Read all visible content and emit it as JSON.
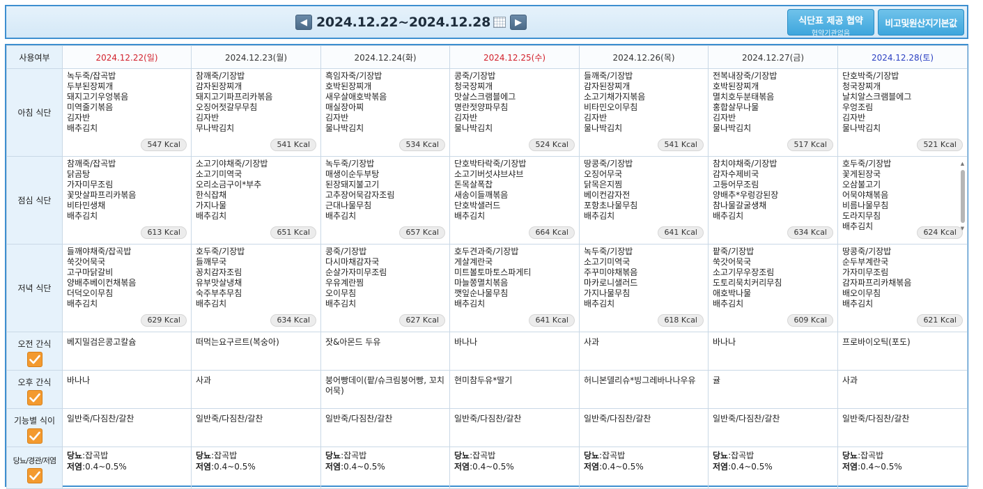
{
  "header": {
    "date_range": "2024.12.22~2024.12.28",
    "prev_icon": "chevron-left-icon",
    "next_icon": "chevron-right-icon",
    "calendar_icon": "calendar-icon",
    "provide_btn_line1": "식단표 제공 협약",
    "provide_btn_line2": "협약기관없음",
    "origin_btn": "비고및원산지기본값"
  },
  "table": {
    "corner_label": "사용여부",
    "days": [
      {
        "label": "2024.12.22(일)",
        "kind": "sun"
      },
      {
        "label": "2024.12.23(월)",
        "kind": "normal"
      },
      {
        "label": "2024.12.24(화)",
        "kind": "normal"
      },
      {
        "label": "2024.12.25(수)",
        "kind": "hol"
      },
      {
        "label": "2024.12.26(목)",
        "kind": "normal"
      },
      {
        "label": "2024.12.27(금)",
        "kind": "normal"
      },
      {
        "label": "2024.12.28(토)",
        "kind": "sat"
      }
    ],
    "meals": [
      {
        "label": "아침 식단",
        "days": [
          {
            "items": [
              "녹두죽/잡곡밥",
              "두부된장찌개",
              "돼지고기우엉볶음",
              "미역줄기볶음",
              "김자반",
              "배추김치"
            ],
            "kcal": "547 Kcal"
          },
          {
            "items": [
              "참깨죽/기장밥",
              "감자된장찌개",
              "돼지고기파프리카볶음",
              "오징어젓갈무무침",
              "김자반",
              "무나박김치"
            ],
            "kcal": "541 Kcal"
          },
          {
            "items": [
              "흑임자죽/기장밥",
              "호박된장찌개",
              "새우살애호박볶음",
              "매실장아찌",
              "김자반",
              "물나박김치"
            ],
            "kcal": "534 Kcal"
          },
          {
            "items": [
              "콩죽/기장밥",
              "청국장찌개",
              "맛살스크램블에그",
              "명란젓양파무침",
              "김자반",
              "물나박김치"
            ],
            "kcal": "524 Kcal"
          },
          {
            "items": [
              "들깨죽/기장밥",
              "감자된장찌개",
              "소고기채가지볶음",
              "비타민오이무침",
              "김자반",
              "물나박김치"
            ],
            "kcal": "541 Kcal"
          },
          {
            "items": [
              "전복내장죽/기장밥",
              "호박된장찌개",
              "멸치호두분태볶음",
              "홍합살무나물",
              "김자반",
              "물나박김치"
            ],
            "kcal": "517 Kcal"
          },
          {
            "items": [
              "단호박죽/기장밥",
              "청국장찌개",
              "날치알스크램블에그",
              "우엉조림",
              "김자반",
              "물나박김치"
            ],
            "kcal": "521 Kcal"
          }
        ]
      },
      {
        "label": "점심 식단",
        "days": [
          {
            "items": [
              "참깨죽/잡곡밥",
              "닭곰탕",
              "가자미무조림",
              "꽃맛살파프리카볶음",
              "비타민생채",
              "배추김치"
            ],
            "kcal": "613 Kcal"
          },
          {
            "items": [
              "소고기야채죽/기장밥",
              "소고기미역국",
              "오리소금구이*부추",
              "한식잡채",
              "가지나물",
              "배추김치"
            ],
            "kcal": "651 Kcal"
          },
          {
            "items": [
              "녹두죽/기장밥",
              "매생이순두부탕",
              "된장돼지불고기",
              "고추장어묵감자조림",
              "근대나물무침",
              "배추김치"
            ],
            "kcal": "657 Kcal"
          },
          {
            "items": [
              "단호박타락죽/기장밥",
              "소고기버섯샤브샤브",
              "돈목살폭찹",
              "새송이들깨볶음",
              "단호박샐러드",
              "배추김치"
            ],
            "kcal": "664 Kcal"
          },
          {
            "items": [
              "땅콩죽/기장밥",
              "오징어무국",
              "닭목은지찜",
              "베이컨감자전",
              "포항초나물무침",
              "배추김치"
            ],
            "kcal": "641 Kcal"
          },
          {
            "items": [
              "참치야채죽/기장밥",
              "감자수제비국",
              "고등어무조림",
              "양배추*우렁강된장",
              "참나물갈굴생채",
              "배추김치"
            ],
            "kcal": "634 Kcal"
          },
          {
            "items": [
              "호두죽/기장밥",
              "꽃게된장국",
              "오삼불고기",
              "어묵야채볶음",
              "비름나물무침",
              "도라지무침",
              "배추김치"
            ],
            "kcal": "624 Kcal"
          }
        ]
      },
      {
        "label": "저녁 식단",
        "days": [
          {
            "items": [
              "들깨야채죽/잡곡밥",
              "쑥갓어묵국",
              "고구마닭갈비",
              "양배추베이컨채볶음",
              "더덕오이무침",
              "배추김치"
            ],
            "kcal": "629 Kcal"
          },
          {
            "items": [
              "호두죽/기장밥",
              "들깨무국",
              "꽁치감자조림",
              "유부맛살냉채",
              "숙주부추무침",
              "배추김치"
            ],
            "kcal": "634 Kcal"
          },
          {
            "items": [
              "콩죽/기장밥",
              "다시마채감자국",
              "순살가자미무조림",
              "우유계란찜",
              "오이무침",
              "배추김치"
            ],
            "kcal": "627 Kcal"
          },
          {
            "items": [
              "호두견과죽/기장밥",
              "게살계란국",
              "미트볼토마토스파게티",
              "마늘쫑멸치볶음",
              "깻잎순나물무침",
              "배추김치"
            ],
            "kcal": "641 Kcal"
          },
          {
            "items": [
              "녹두죽/기장밥",
              "소고기미역국",
              "주꾸미야채볶음",
              "마카로니샐러드",
              "가지나물무침",
              "배추김치"
            ],
            "kcal": "618 Kcal"
          },
          {
            "items": [
              "팥죽/기장밥",
              "쑥갓어묵국",
              "소고기무우장조림",
              "도토리묵치커리무침",
              "애호박나물",
              "배추김치"
            ],
            "kcal": "609 Kcal"
          },
          {
            "items": [
              "땅콩죽/기장밥",
              "순두부계란국",
              "가자미무조림",
              "감자파프리카채볶음",
              "배오이무침",
              "배추김치"
            ],
            "kcal": "621 Kcal"
          }
        ]
      }
    ],
    "snacks": [
      {
        "label": "오전 간식",
        "days": [
          "베지밀검은콩고칼슘",
          "떠먹는요구르트(복숭아)",
          "잣&아몬드 두유",
          "바나나",
          "사과",
          "바나나",
          "프로바이오틱(포도)"
        ]
      },
      {
        "label": "오후 간식",
        "days": [
          "바나나",
          "사과",
          "붕어빵데이(팥/슈크림붕어빵, 꼬치어묵)",
          "현미참두유*딸기",
          "허니본델리슈*빙그레바나나우유",
          "귤",
          "사과"
        ]
      },
      {
        "label": "기능별 식이",
        "days": [
          "일반죽/다짐찬/갈찬",
          "일반죽/다짐찬/갈찬",
          "일반죽/다짐찬/갈찬",
          "일반죽/다짐찬/갈찬",
          "일반죽/다짐찬/갈찬",
          "일반죽/다짐찬/갈찬",
          "일반죽/다짐찬/갈찬"
        ]
      }
    ],
    "diet": {
      "label": "당뇨/경관/저염",
      "line1_key": "당뇨",
      "line1_val": ":잡곡밥",
      "line2_key": "저염",
      "line2_val": ":0.4~0.5%"
    }
  }
}
